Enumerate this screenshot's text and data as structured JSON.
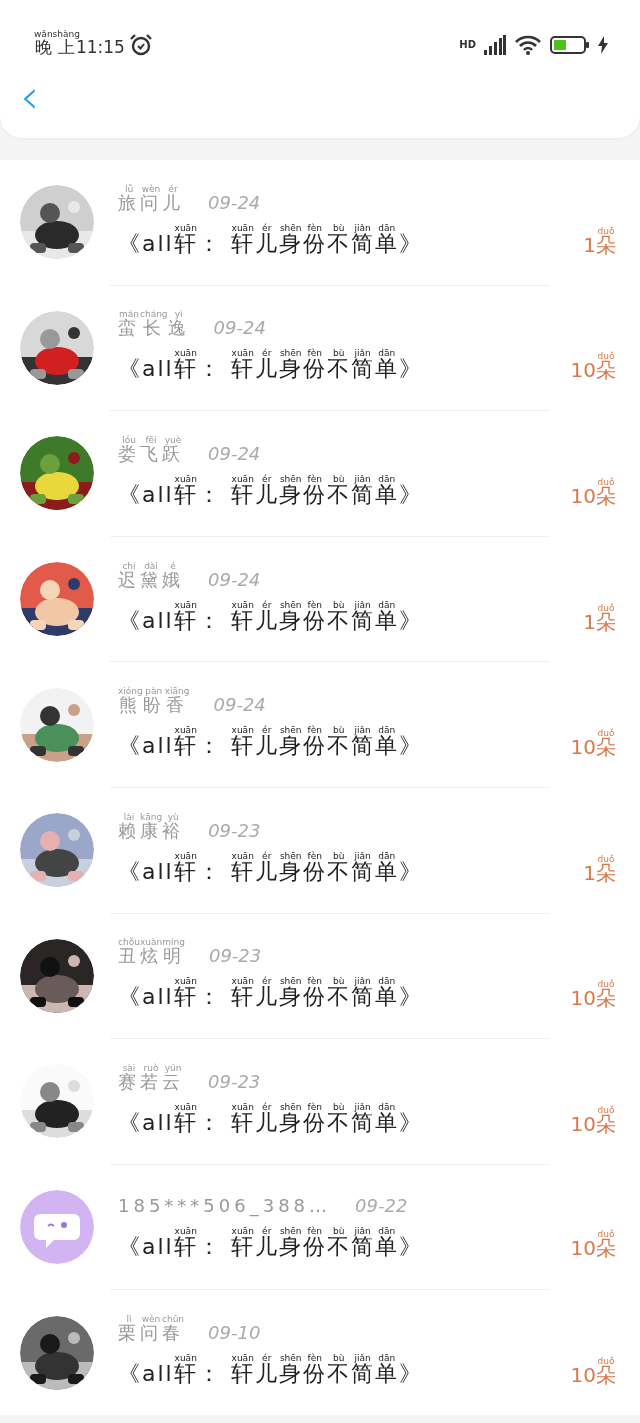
{
  "status_bar": {
    "time": [
      {
        "text": "晚",
        "pinyin": "wǎn"
      },
      {
        "text": "上",
        "pinyin": "shàng"
      },
      {
        "text": "11:15"
      }
    ],
    "network": "HD"
  },
  "nav": {
    "back": "‹"
  },
  "records": [
    {
      "avatar": {
        "kind": "picture"
      },
      "name": [
        {
          "text": "旅",
          "pinyin": "lǚ"
        },
        {
          "text": "问",
          "pinyin": "wèn"
        },
        {
          "text": "儿",
          "pinyin": "ér"
        }
      ],
      "date": "09-24",
      "title": [
        {
          "text": "《all"
        },
        {
          "text": "轩",
          "pinyin": "xuān"
        },
        {
          "text": "： "
        },
        {
          "text": "轩",
          "pinyin": "xuān"
        },
        {
          "text": "儿",
          "pinyin": "ér"
        },
        {
          "text": "身",
          "pinyin": "shēn"
        },
        {
          "text": "份",
          "pinyin": "fèn"
        },
        {
          "text": "不",
          "pinyin": "bù"
        },
        {
          "text": "简",
          "pinyin": "jiǎn"
        },
        {
          "text": "单",
          "pinyin": "dān"
        },
        {
          "text": "》"
        }
      ],
      "count": [
        {
          "text": "1"
        },
        {
          "text": "朵",
          "pinyin": "duǒ"
        }
      ]
    },
    {
      "avatar": {
        "kind": "picture"
      },
      "name": [
        {
          "text": "蛮",
          "pinyin": "mán"
        },
        {
          "text": "长",
          "pinyin": "cháng"
        },
        {
          "text": "逸",
          "pinyin": "yì"
        }
      ],
      "date": "09-24",
      "title": [
        {
          "text": "《all"
        },
        {
          "text": "轩",
          "pinyin": "xuān"
        },
        {
          "text": "： "
        },
        {
          "text": "轩",
          "pinyin": "xuān"
        },
        {
          "text": "儿",
          "pinyin": "ér"
        },
        {
          "text": "身",
          "pinyin": "shēn"
        },
        {
          "text": "份",
          "pinyin": "fèn"
        },
        {
          "text": "不",
          "pinyin": "bù"
        },
        {
          "text": "简",
          "pinyin": "jiǎn"
        },
        {
          "text": "单",
          "pinyin": "dān"
        },
        {
          "text": "》"
        }
      ],
      "count": [
        {
          "text": "10"
        },
        {
          "text": "朵",
          "pinyin": "duǒ"
        }
      ]
    },
    {
      "avatar": {
        "kind": "picture"
      },
      "name": [
        {
          "text": "娄",
          "pinyin": "lóu"
        },
        {
          "text": "飞",
          "pinyin": "fēi"
        },
        {
          "text": "跃",
          "pinyin": "yuè"
        }
      ],
      "date": "09-24",
      "title": [
        {
          "text": "《all"
        },
        {
          "text": "轩",
          "pinyin": "xuān"
        },
        {
          "text": "： "
        },
        {
          "text": "轩",
          "pinyin": "xuān"
        },
        {
          "text": "儿",
          "pinyin": "ér"
        },
        {
          "text": "身",
          "pinyin": "shēn"
        },
        {
          "text": "份",
          "pinyin": "fèn"
        },
        {
          "text": "不",
          "pinyin": "bù"
        },
        {
          "text": "简",
          "pinyin": "jiǎn"
        },
        {
          "text": "单",
          "pinyin": "dān"
        },
        {
          "text": "》"
        }
      ],
      "count": [
        {
          "text": "10"
        },
        {
          "text": "朵",
          "pinyin": "duǒ"
        }
      ]
    },
    {
      "avatar": {
        "kind": "picture"
      },
      "name": [
        {
          "text": "迟",
          "pinyin": "chí"
        },
        {
          "text": "黛",
          "pinyin": "dài"
        },
        {
          "text": "娥",
          "pinyin": "é"
        }
      ],
      "date": "09-24",
      "title": [
        {
          "text": "《all"
        },
        {
          "text": "轩",
          "pinyin": "xuān"
        },
        {
          "text": "： "
        },
        {
          "text": "轩",
          "pinyin": "xuān"
        },
        {
          "text": "儿",
          "pinyin": "ér"
        },
        {
          "text": "身",
          "pinyin": "shēn"
        },
        {
          "text": "份",
          "pinyin": "fèn"
        },
        {
          "text": "不",
          "pinyin": "bù"
        },
        {
          "text": "简",
          "pinyin": "jiǎn"
        },
        {
          "text": "单",
          "pinyin": "dān"
        },
        {
          "text": "》"
        }
      ],
      "count": [
        {
          "text": "1"
        },
        {
          "text": "朵",
          "pinyin": "duǒ"
        }
      ]
    },
    {
      "avatar": {
        "kind": "picture"
      },
      "name": [
        {
          "text": "熊",
          "pinyin": "xióng"
        },
        {
          "text": "盼",
          "pinyin": "pàn"
        },
        {
          "text": "香",
          "pinyin": "xiāng"
        }
      ],
      "date": "09-24",
      "title": [
        {
          "text": "《all"
        },
        {
          "text": "轩",
          "pinyin": "xuān"
        },
        {
          "text": "： "
        },
        {
          "text": "轩",
          "pinyin": "xuān"
        },
        {
          "text": "儿",
          "pinyin": "ér"
        },
        {
          "text": "身",
          "pinyin": "shēn"
        },
        {
          "text": "份",
          "pinyin": "fèn"
        },
        {
          "text": "不",
          "pinyin": "bù"
        },
        {
          "text": "简",
          "pinyin": "jiǎn"
        },
        {
          "text": "单",
          "pinyin": "dān"
        },
        {
          "text": "》"
        }
      ],
      "count": [
        {
          "text": "10"
        },
        {
          "text": "朵",
          "pinyin": "duǒ"
        }
      ]
    },
    {
      "avatar": {
        "kind": "picture"
      },
      "name": [
        {
          "text": "赖",
          "pinyin": "lài"
        },
        {
          "text": "康",
          "pinyin": "kāng"
        },
        {
          "text": "裕",
          "pinyin": "yù"
        }
      ],
      "date": "09-23",
      "title": [
        {
          "text": "《all"
        },
        {
          "text": "轩",
          "pinyin": "xuān"
        },
        {
          "text": "： "
        },
        {
          "text": "轩",
          "pinyin": "xuān"
        },
        {
          "text": "儿",
          "pinyin": "ér"
        },
        {
          "text": "身",
          "pinyin": "shēn"
        },
        {
          "text": "份",
          "pinyin": "fèn"
        },
        {
          "text": "不",
          "pinyin": "bù"
        },
        {
          "text": "简",
          "pinyin": "jiǎn"
        },
        {
          "text": "单",
          "pinyin": "dān"
        },
        {
          "text": "》"
        }
      ],
      "count": [
        {
          "text": "1"
        },
        {
          "text": "朵",
          "pinyin": "duǒ"
        }
      ]
    },
    {
      "avatar": {
        "kind": "picture"
      },
      "name": [
        {
          "text": "丑",
          "pinyin": "chǒu"
        },
        {
          "text": "炫",
          "pinyin": "xuàn"
        },
        {
          "text": "明",
          "pinyin": "míng"
        }
      ],
      "date": "09-23",
      "title": [
        {
          "text": "《all"
        },
        {
          "text": "轩",
          "pinyin": "xuān"
        },
        {
          "text": "： "
        },
        {
          "text": "轩",
          "pinyin": "xuān"
        },
        {
          "text": "儿",
          "pinyin": "ér"
        },
        {
          "text": "身",
          "pinyin": "shēn"
        },
        {
          "text": "份",
          "pinyin": "fèn"
        },
        {
          "text": "不",
          "pinyin": "bù"
        },
        {
          "text": "简",
          "pinyin": "jiǎn"
        },
        {
          "text": "单",
          "pinyin": "dān"
        },
        {
          "text": "》"
        }
      ],
      "count": [
        {
          "text": "10"
        },
        {
          "text": "朵",
          "pinyin": "duǒ"
        }
      ]
    },
    {
      "avatar": {
        "kind": "picture"
      },
      "name": [
        {
          "text": "赛",
          "pinyin": "sài"
        },
        {
          "text": "若",
          "pinyin": "ruò"
        },
        {
          "text": "云",
          "pinyin": "yún"
        }
      ],
      "date": "09-23",
      "title": [
        {
          "text": "《all"
        },
        {
          "text": "轩",
          "pinyin": "xuān"
        },
        {
          "text": "： "
        },
        {
          "text": "轩",
          "pinyin": "xuān"
        },
        {
          "text": "儿",
          "pinyin": "ér"
        },
        {
          "text": "身",
          "pinyin": "shēn"
        },
        {
          "text": "份",
          "pinyin": "fèn"
        },
        {
          "text": "不",
          "pinyin": "bù"
        },
        {
          "text": "简",
          "pinyin": "jiǎn"
        },
        {
          "text": "单",
          "pinyin": "dān"
        },
        {
          "text": "》"
        }
      ],
      "count": [
        {
          "text": "10"
        },
        {
          "text": "朵",
          "pinyin": "duǒ"
        }
      ]
    },
    {
      "avatar": {
        "kind": "default"
      },
      "name": [
        {
          "text": "185***506_388…"
        }
      ],
      "date": "09-22",
      "title": [
        {
          "text": "《all"
        },
        {
          "text": "轩",
          "pinyin": "xuān"
        },
        {
          "text": "： "
        },
        {
          "text": "轩",
          "pinyin": "xuān"
        },
        {
          "text": "儿",
          "pinyin": "ér"
        },
        {
          "text": "身",
          "pinyin": "shēn"
        },
        {
          "text": "份",
          "pinyin": "fèn"
        },
        {
          "text": "不",
          "pinyin": "bù"
        },
        {
          "text": "简",
          "pinyin": "jiǎn"
        },
        {
          "text": "单",
          "pinyin": "dān"
        },
        {
          "text": "》"
        }
      ],
      "count": [
        {
          "text": "10"
        },
        {
          "text": "朵",
          "pinyin": "duǒ"
        }
      ]
    },
    {
      "avatar": {
        "kind": "picture"
      },
      "name": [
        {
          "text": "栗",
          "pinyin": "lì"
        },
        {
          "text": "问",
          "pinyin": "wèn"
        },
        {
          "text": "春",
          "pinyin": "chūn"
        }
      ],
      "date": "09-10",
      "title": [
        {
          "text": "《all"
        },
        {
          "text": "轩",
          "pinyin": "xuān"
        },
        {
          "text": "： "
        },
        {
          "text": "轩",
          "pinyin": "xuān"
        },
        {
          "text": "儿",
          "pinyin": "ér"
        },
        {
          "text": "身",
          "pinyin": "shēn"
        },
        {
          "text": "份",
          "pinyin": "fèn"
        },
        {
          "text": "不",
          "pinyin": "bù"
        },
        {
          "text": "简",
          "pinyin": "jiǎn"
        },
        {
          "text": "单",
          "pinyin": "dān"
        },
        {
          "text": "》"
        }
      ],
      "count": [
        {
          "text": "10"
        },
        {
          "text": "朵",
          "pinyin": "duǒ"
        }
      ]
    }
  ]
}
